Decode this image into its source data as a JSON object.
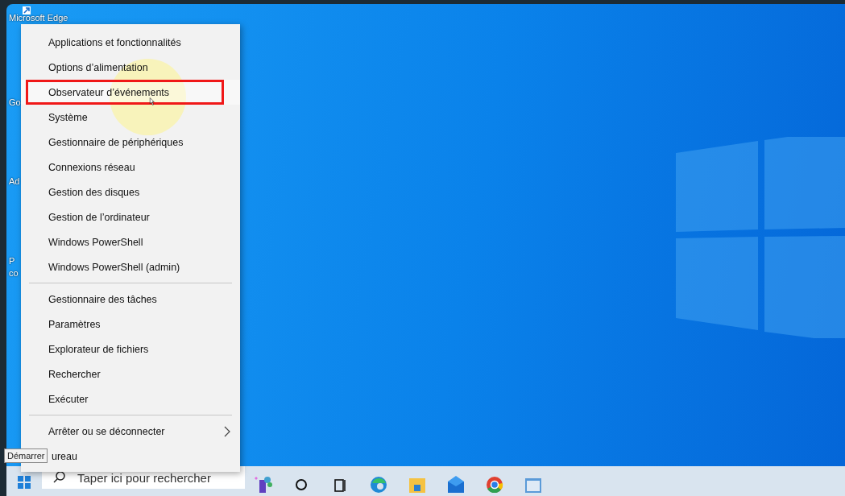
{
  "desktop_icons": [
    {
      "label": "Microsoft Edge"
    },
    {
      "label": "Go"
    },
    {
      "label": "Ad"
    },
    {
      "label": "P"
    },
    {
      "label": "co"
    }
  ],
  "menu": {
    "groups": [
      {
        "items": [
          {
            "label": "Applications et fonctionnalités",
            "selected": false,
            "submenu": false
          },
          {
            "label": "Options d’alimentation",
            "selected": false,
            "submenu": false
          },
          {
            "label": "Observateur d’événements",
            "selected": true,
            "submenu": false
          },
          {
            "label": "Système",
            "selected": false,
            "submenu": false
          },
          {
            "label": "Gestionnaire de périphériques",
            "selected": false,
            "submenu": false
          },
          {
            "label": "Connexions réseau",
            "selected": false,
            "submenu": false
          },
          {
            "label": "Gestion des disques",
            "selected": false,
            "submenu": false
          },
          {
            "label": "Gestion de l’ordinateur",
            "selected": false,
            "submenu": false
          },
          {
            "label": "Windows PowerShell",
            "selected": false,
            "submenu": false
          },
          {
            "label": "Windows PowerShell (admin)",
            "selected": false,
            "submenu": false
          }
        ]
      },
      {
        "items": [
          {
            "label": "Gestionnaire des tâches",
            "selected": false,
            "submenu": false
          },
          {
            "label": "Paramètres",
            "selected": false,
            "submenu": false
          },
          {
            "label": "Explorateur de fichiers",
            "selected": false,
            "submenu": false
          },
          {
            "label": "Rechercher",
            "selected": false,
            "submenu": false
          },
          {
            "label": "Exécuter",
            "selected": false,
            "submenu": false
          }
        ]
      },
      {
        "items": [
          {
            "label": "Arrêter ou se déconnecter",
            "selected": false,
            "submenu": true
          },
          {
            "label": "ureau",
            "selected": false,
            "submenu": false
          }
        ]
      }
    ]
  },
  "tooltip": {
    "text": "Démarrer"
  },
  "taskbar": {
    "search": {
      "placeholder": "Taper ici pour rechercher"
    },
    "apps": [
      {
        "kind": "widgets"
      },
      {
        "kind": "cortana"
      },
      {
        "kind": "taskview"
      },
      {
        "kind": "edge"
      },
      {
        "kind": "explorer"
      },
      {
        "kind": "mail"
      },
      {
        "kind": "chrome"
      },
      {
        "kind": "app"
      }
    ]
  }
}
